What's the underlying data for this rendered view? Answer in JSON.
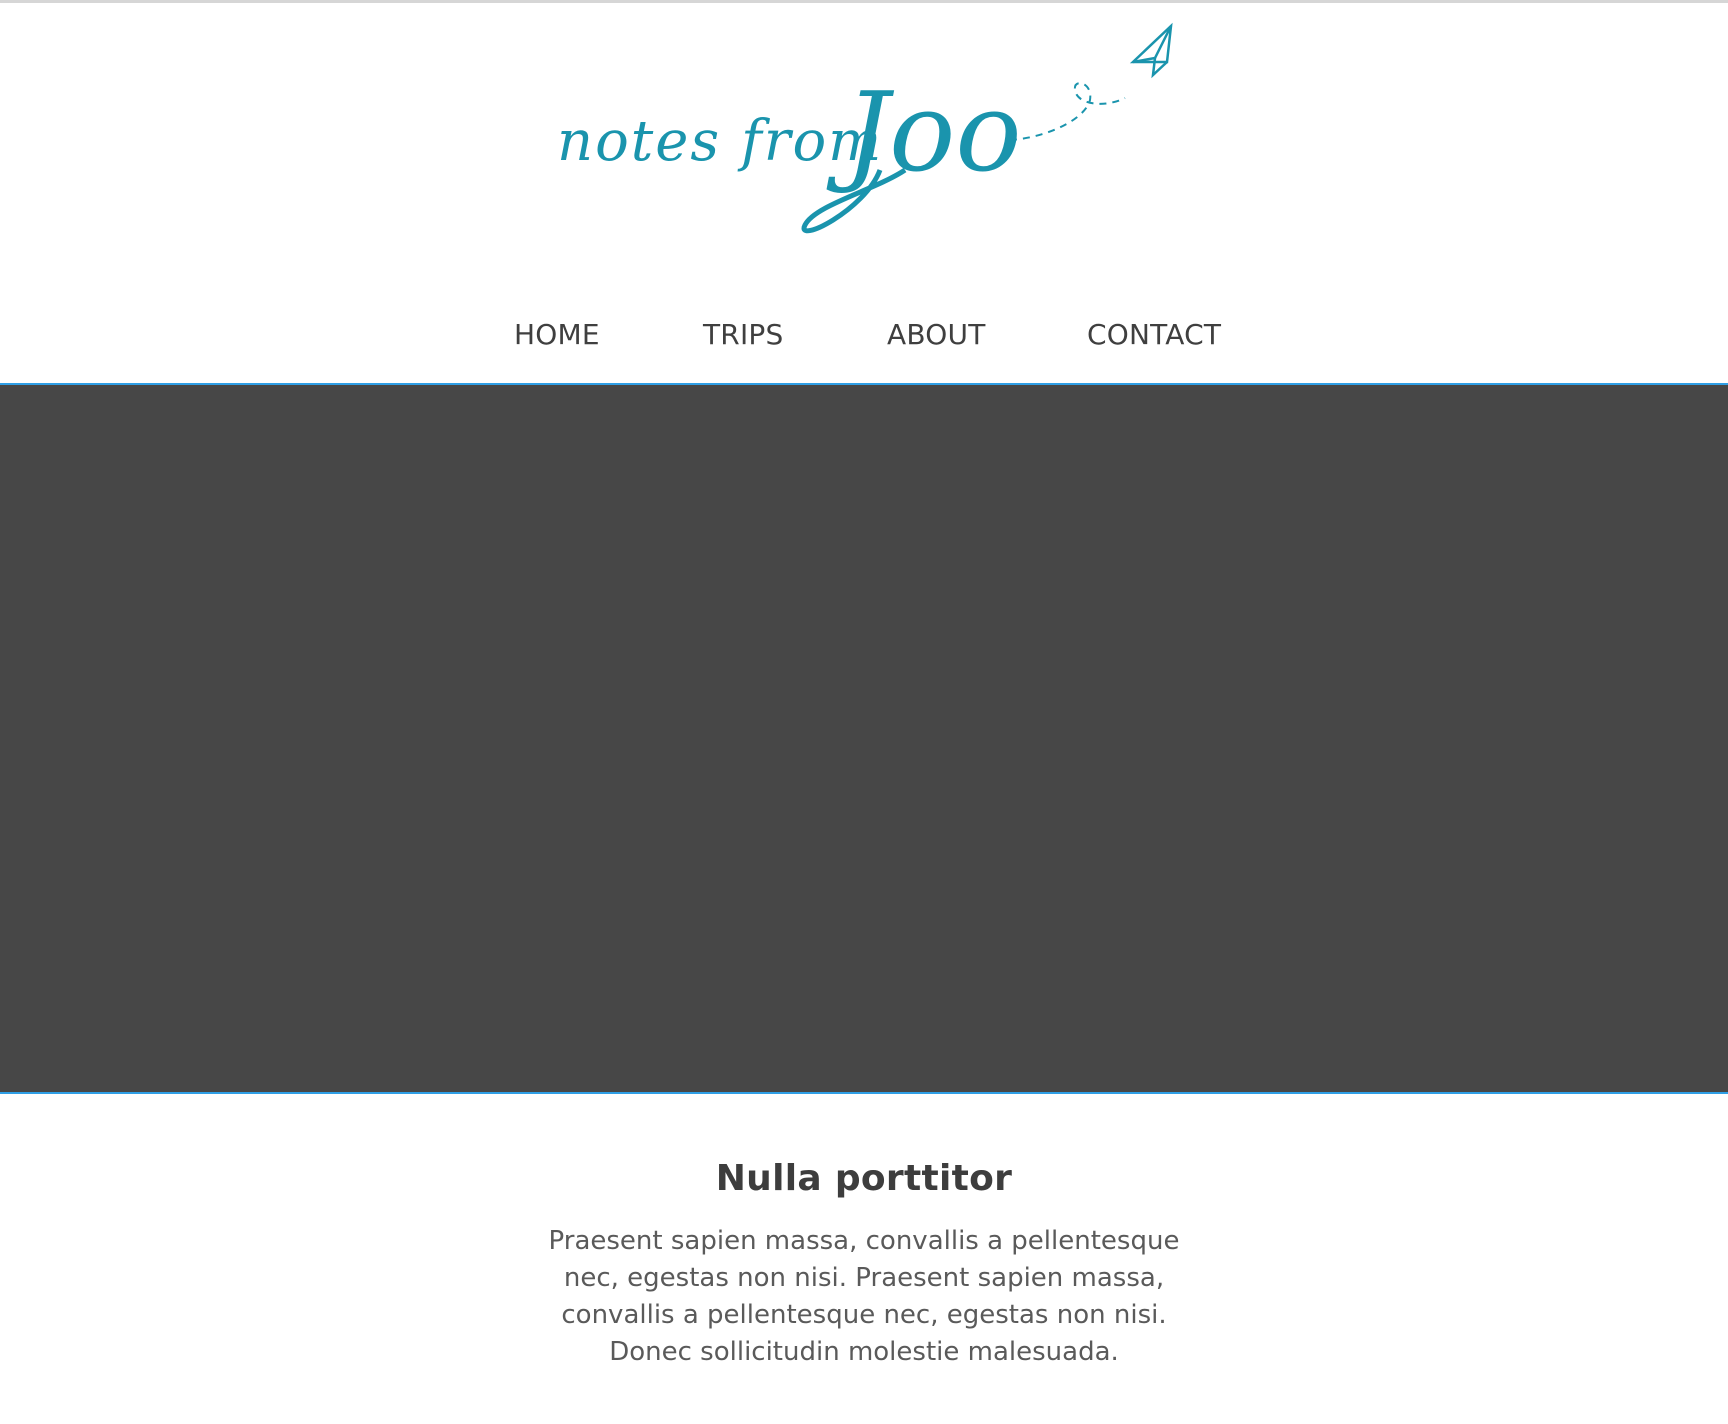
{
  "logo": {
    "text_script": "notes from",
    "text_name": "Joo",
    "icon": "paper-plane-icon",
    "color": "#1a94ad"
  },
  "nav": {
    "items": [
      {
        "label": "HOME"
      },
      {
        "label": "TRIPS"
      },
      {
        "label": "ABOUT"
      },
      {
        "label": "CONTACT"
      }
    ]
  },
  "hero": {
    "background": "#474747",
    "border_color": "#2f9fe6"
  },
  "content": {
    "heading": "Nulla porttitor",
    "body": "Praesent sapien massa, convallis a pellentesque nec, egestas non nisi. Praesent sapien massa, convallis a pellentesque nec, egestas non nisi. Donec sollicitudin molestie malesuada."
  }
}
